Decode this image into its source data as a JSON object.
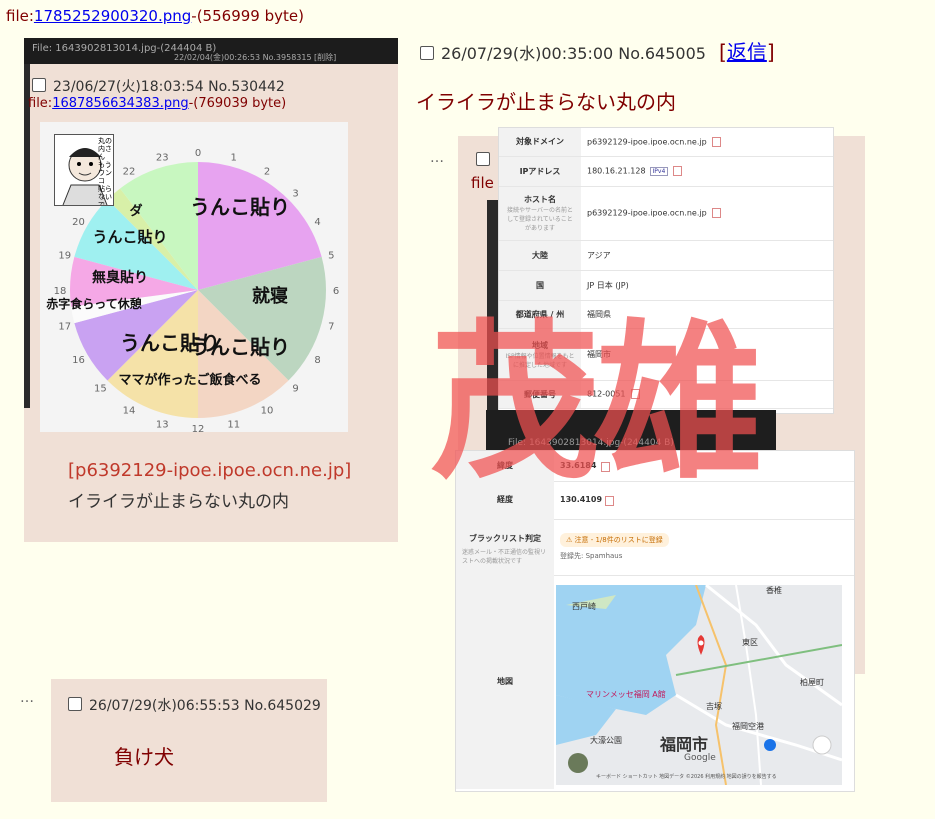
{
  "file_line": {
    "prefix": "file:",
    "name": "1785252900320.png",
    "size": "-(556999 byte)"
  },
  "left_post": {
    "strip_left": "File: 1643902813014.jpg-(244404 B)",
    "strip_right": "22/02/04(金)00:26:53 No.3958315",
    "strip_del": "[削除]",
    "date": "23/06/27(火)18:03:54 No.530442",
    "file_prefix": "file:",
    "file_name": "1687856634383.png",
    "file_size": "-(769039 byte)",
    "manga_caption": "丸の内さん もうウンコ 貼らないで 下さいね",
    "ip": "[p6392129-ipoe.ipoe.ocn.ne.jp]",
    "msg": "イライラが止まらない丸の内"
  },
  "chart_data": {
    "type": "pie",
    "title": "",
    "hour_labels": [
      "0",
      "1",
      "2",
      "3",
      "4",
      "5",
      "6",
      "7",
      "8",
      "9",
      "10",
      "11",
      "12",
      "13",
      "14",
      "15",
      "16",
      "17",
      "18",
      "19",
      "20",
      "21",
      "22",
      "23"
    ],
    "slices": [
      {
        "label": "うんこ貼り",
        "start": 0,
        "end": 5,
        "color": "#e7a3f0"
      },
      {
        "label": "就寝",
        "start": 5,
        "end": 9,
        "color": "#bcd6c0"
      },
      {
        "label": "うんこ貼り",
        "start": 9,
        "end": 12,
        "color": "#f3d6c4"
      },
      {
        "label": "ママが作ったご飯食べる",
        "start": 12,
        "end": 15,
        "color": "#f5e2a8"
      },
      {
        "label": "うんこ貼り",
        "start": 15,
        "end": 17,
        "color": "#c9a2f2"
      },
      {
        "label": "赤字食らって休憩",
        "start": 17,
        "end": 17.5,
        "color": "#fbfbfb"
      },
      {
        "label": "無臭貼り",
        "start": 17.5,
        "end": 19,
        "color": "#f5a8e6"
      },
      {
        "label": "うんこ貼り",
        "start": 19,
        "end": 21,
        "color": "#9ff0f0"
      },
      {
        "label": "ダ",
        "start": 21,
        "end": 21.5,
        "color": "#d8f0a8"
      },
      {
        "label": "",
        "start": 21.5,
        "end": 24,
        "color": "#c8f7c0"
      }
    ],
    "text_labels": [
      "うんこ貼り",
      "うんこ貼り",
      "就寝",
      "無臭貼り",
      "赤字食らって休憩",
      "うんこ貼り",
      "うんこ貼り",
      "ママが作ったご飯食べる",
      "ダ"
    ]
  },
  "reply_main": {
    "date": "26/07/29(水)00:35:00 No.645005",
    "return_open": "[",
    "return_label": "返信",
    "return_close": "]",
    "msg": "イライラが止まらない丸の内",
    "dots": "…"
  },
  "back_reply": {
    "file_label": "file"
  },
  "info_table": {
    "rows": [
      {
        "k": "対象ドメイン",
        "v": "p6392129-ipoe.ipoe.ocn.ne.jp"
      },
      {
        "k": "IPアドレス",
        "v": "180.16.21.128",
        "tag": "IPv4"
      },
      {
        "k": "ホスト名",
        "sub": "接続やサーバーの名前として登録されていることがあります",
        "v": "p6392129-ipoe.ipoe.ocn.ne.jp"
      },
      {
        "k": "大陸",
        "v": "アジア"
      },
      {
        "k": "国",
        "v": "JP 日本 (JP)"
      },
      {
        "k": "都道府県 / 州",
        "v": "福岡県"
      },
      {
        "k": "地域",
        "sub": "ISP情報や位置情報をもとに推定した地域です",
        "v": "福岡市"
      },
      {
        "k": "郵便番号",
        "v": "812-0051"
      }
    ]
  },
  "dark_strip_h": "File: 1643902813014.jpg-(244404 B)",
  "info2": {
    "lat_k": "緯度",
    "lat_v": "33.6184",
    "lon_k": "経度",
    "lon_v": "130.4109",
    "bl_k": "ブラックリスト判定",
    "bl_sub": "迷惑メール・不正通信の監視リストへの掲載状況です",
    "bl_warn": "⚠ 注意 - 1/8件のリストに登録",
    "bl_src": "登録先: Spamhaus",
    "map_k": "地図",
    "map_labels": {
      "city": "福岡市",
      "nishi": "西戸崎",
      "messe": "マリンメッセ福岡 A館",
      "higashi": "東区",
      "kashii": "香椎",
      "kashiwa": "柏屋町",
      "yoshizuka": "吉塚",
      "hakata": "福岡空港",
      "ohori": "大濠公園",
      "google": "Google",
      "footer": "キーボード ショートカット 地図データ ©2026 利用規約 地図の誤りを報告する"
    }
  },
  "stamp": "茂雄",
  "bottom_reply": {
    "dots": "…",
    "date": "26/07/29(水)06:55:53 No.645029",
    "msg": "負け犬"
  }
}
